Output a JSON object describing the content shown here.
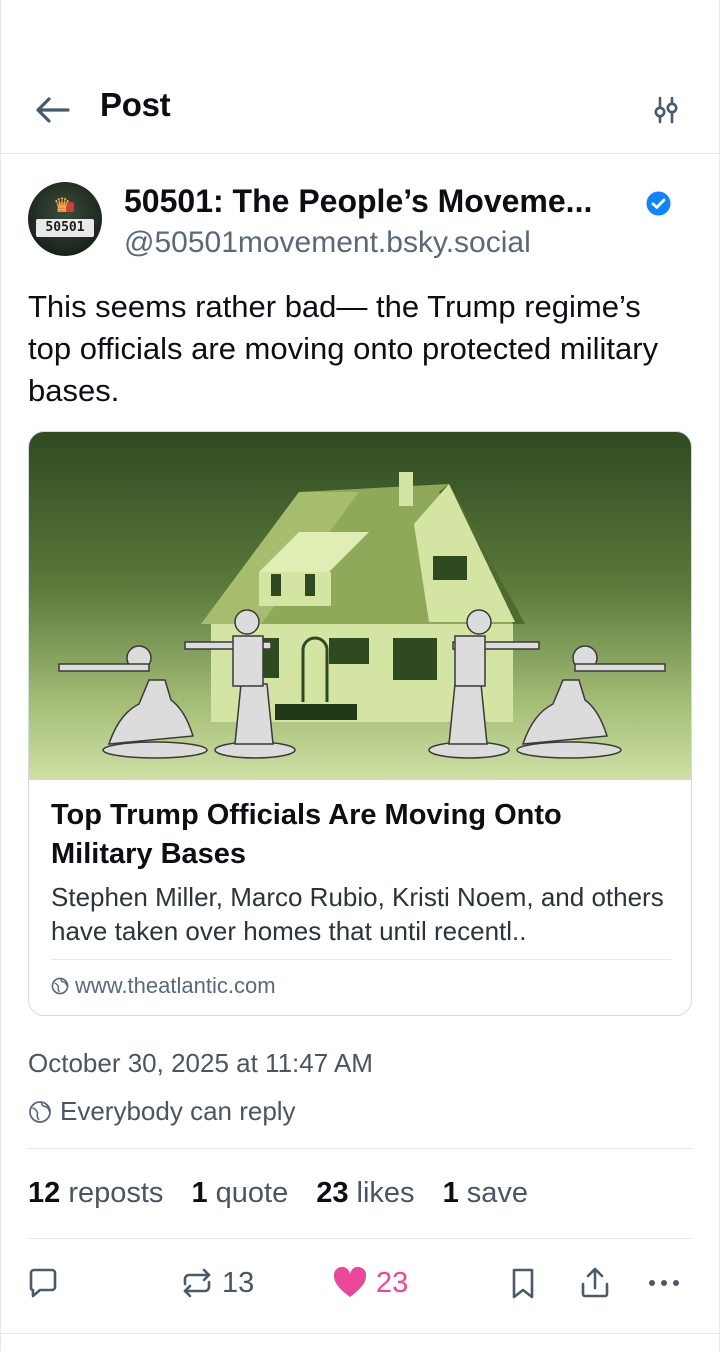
{
  "header": {
    "title": "Post"
  },
  "author": {
    "display_name": "50501: The People’s Moveme...",
    "handle": "@50501movement.bsky.social",
    "avatar_text": "50501",
    "verified": true
  },
  "post": {
    "text": "This seems rather bad— the Trump regime’s top officials are moving onto protected military bases.",
    "timestamp": "October 30, 2025 at 11:47 AM",
    "reply_setting": "Everybody can reply"
  },
  "link_card": {
    "title": "Top Trump Officials Are Moving Onto Military Bases",
    "description": "Stephen Miller, Marco Rubio, Kristi Noem, and others have taken over homes that until recentl..",
    "domain": "www.theatlantic.com"
  },
  "stats": {
    "reposts_count": "12",
    "reposts_label": "reposts",
    "quotes_count": "1",
    "quotes_label": "quote",
    "likes_count": "23",
    "likes_label": "likes",
    "saves_count": "1",
    "saves_label": "save"
  },
  "actions": {
    "repost_count": "13",
    "like_count": "23",
    "liked": true
  },
  "colors": {
    "accent_blue": "#1083fe",
    "like_pink": "#ec4899",
    "muted_text": "#59687a",
    "image_green_dark": "#2f4a21",
    "image_house": "#d4e5a3"
  },
  "icons": {
    "back": "arrow-left-icon",
    "filter": "sliders-icon",
    "verified": "verified-check-icon",
    "globe": "globe-icon",
    "reply": "speech-bubble-icon",
    "repost": "repost-icon",
    "like": "heart-icon",
    "bookmark": "bookmark-icon",
    "share": "share-icon",
    "more": "ellipsis-icon"
  }
}
